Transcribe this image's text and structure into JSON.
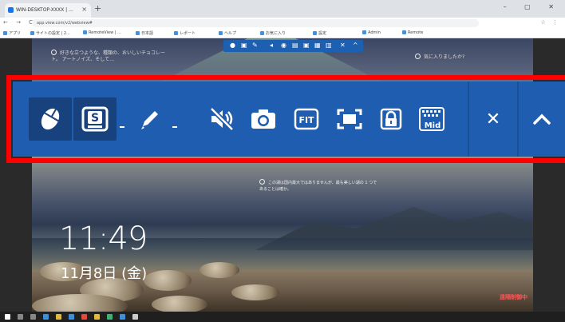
{
  "browser": {
    "tab_title": "WIN-DESKTOP-XXXX | ...",
    "tab_close": "×",
    "new_tab": "+",
    "window_controls": "–  ▢  ✕",
    "nav_buttons": "← → C ⌂",
    "url": "app.view.com/v2/webview#",
    "addr_icons": "☆ ⋮",
    "bookmarks": [
      "アプリ",
      "サイトの設定 | 2...",
      "RemoteView | ...",
      "日本語",
      "レポート",
      "ヘルプ",
      "お気に入り",
      "設定",
      "Admin",
      "Remote"
    ]
  },
  "desktop": {
    "tip_top_left": "好きな立つような、種類の、おいしいチョコレート。 アートノイズ、そして…",
    "tip_top_right": "気に入りましたか?",
    "tip_middle": "この湖は国内最大ではありませんが、最も美しい湖の 1 つであることは確か。",
    "clock": "11:49",
    "date": "11月8日 (金)",
    "remote_control_label": "遠隔制御中"
  },
  "toolbar": {
    "close_glyph": "✕",
    "collapse_glyph": "^",
    "fit_label": "FIT",
    "mid_label": "Mid",
    "s_label": "S",
    "tools": [
      {
        "id": "mouse",
        "icon": "mouse-icon",
        "active": true
      },
      {
        "id": "keyboard",
        "icon": "keyboard-s-icon",
        "active": true
      },
      {
        "id": "pen",
        "icon": "pen-icon",
        "active": false
      },
      {
        "id": "mute",
        "icon": "speaker-muted-icon",
        "active": false
      },
      {
        "id": "screenshot",
        "icon": "camera-icon",
        "active": false
      },
      {
        "id": "fit",
        "icon": "fit-icon",
        "active": false
      },
      {
        "id": "fullscreen",
        "icon": "fullscreen-icon",
        "active": false
      },
      {
        "id": "lock",
        "icon": "lock-icon",
        "active": false
      },
      {
        "id": "quality",
        "icon": "quality-mid-icon",
        "active": false
      },
      {
        "id": "close",
        "icon": "close-icon",
        "active": false
      },
      {
        "id": "collapse",
        "icon": "chevron-up-icon",
        "active": false
      }
    ]
  },
  "colors": {
    "toolbar_bg": "#1f5db1",
    "toolbar_active": "#17427d",
    "highlight_border": "#ff0000",
    "remote_label": "#ff5555"
  }
}
